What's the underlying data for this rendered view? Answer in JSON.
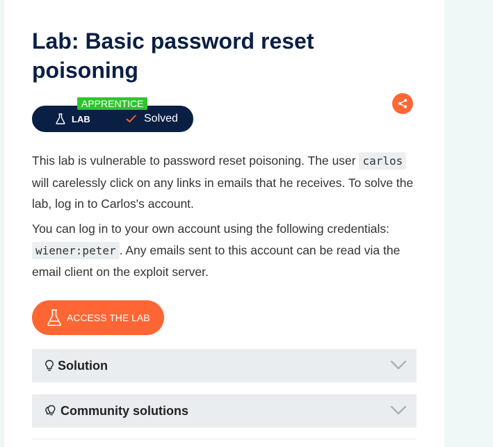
{
  "lab": {
    "title": "Lab: Basic password reset poisoning",
    "level": "APPRENTICE",
    "type_label": "LAB",
    "status": "Solved"
  },
  "description": {
    "p1_before": "This lab is vulnerable to password reset poisoning. The user ",
    "p1_code": "carlos",
    "p1_after": " will carelessly click on any links in emails that he receives. To solve the lab, log in to Carlos's account.",
    "p2_before": "You can log in to your own account using the following credentials: ",
    "p2_code": "wiener:peter",
    "p2_after": ". Any emails sent to this account can be read via the email client on the exploit server."
  },
  "actions": {
    "access_label": "ACCESS THE LAB"
  },
  "accordions": [
    {
      "label": "Solution",
      "icon": "lightbulb-icon"
    },
    {
      "label": "Community solutions",
      "icon": "community-lightbulbs-icon"
    }
  ],
  "colors": {
    "accent": "#ff6633",
    "navy": "#0a1f44",
    "level_green": "#2ec52e"
  }
}
